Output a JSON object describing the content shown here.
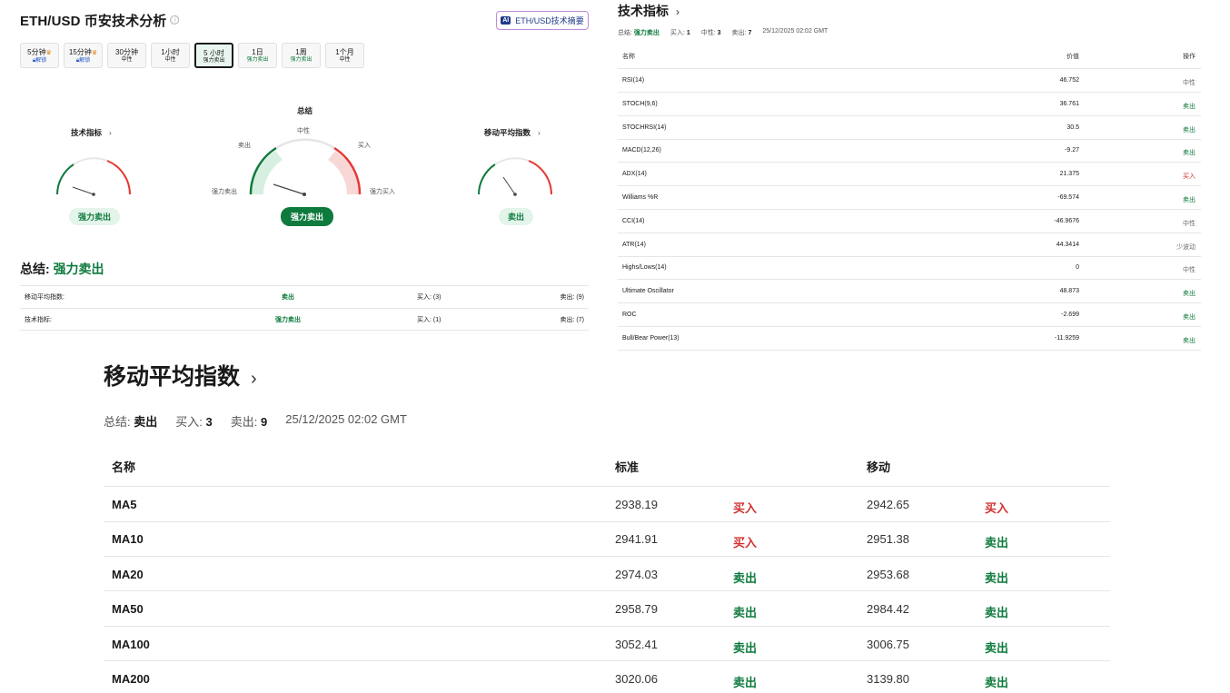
{
  "header": {
    "title": "ETH/USD 币安技术分析",
    "info_icon": "ⓘ",
    "ai_badge": "AI",
    "ai_button": "ETH/USD技术摘要"
  },
  "timeframes": [
    {
      "label": "5分钟",
      "sub": "解锁",
      "locked": true
    },
    {
      "label": "15分钟",
      "sub": "解锁",
      "locked": true
    },
    {
      "label": "30分钟",
      "sub": "中性"
    },
    {
      "label": "1小时",
      "sub": "中性"
    },
    {
      "label": "5 小时",
      "sub": "强力卖出",
      "active": true
    },
    {
      "label": "1日",
      "sub": "强力卖出"
    },
    {
      "label": "1周",
      "sub": "强力卖出"
    },
    {
      "label": "1个月",
      "sub": "中性"
    }
  ],
  "gauges": {
    "technical": {
      "label": "技术指标",
      "result": "强力卖出"
    },
    "summary": {
      "label": "总结",
      "result": "强力卖出",
      "neutral": "中性",
      "sell": "卖出",
      "buy": "买入",
      "strong_sell": "强力卖出",
      "strong_buy": "强力买入"
    },
    "moving_avg": {
      "label": "移动平均指数",
      "result": "卖出"
    },
    "chevron": "›"
  },
  "summary": {
    "title_prefix": "总结:",
    "title_value": "强力卖出",
    "rows": [
      {
        "name": "移动平均指数:",
        "result": "卖出",
        "buy": "买入: (3)",
        "sell": "卖出: (9)"
      },
      {
        "name": "技术指标:",
        "result": "强力卖出",
        "buy": "买入: (1)",
        "sell": "卖出: (7)"
      }
    ]
  },
  "tech_table": {
    "title": "技术指标",
    "sum_label": "总结:",
    "sum_value": "强力卖出",
    "buy_label": "买入:",
    "buy_count": "1",
    "neutral_label": "中性:",
    "neutral_count": "3",
    "sell_label": "卖出:",
    "sell_count": "7",
    "time": "25/12/2025 02:02 GMT",
    "headers": {
      "name": "名称",
      "value": "价值",
      "action": "操作"
    },
    "rows": [
      {
        "name": "RSI(14)",
        "value": "46.752",
        "action": "中性",
        "tone": "gray"
      },
      {
        "name": "STOCH(9,6)",
        "value": "36.761",
        "action": "卖出",
        "tone": "green"
      },
      {
        "name": "STOCHRSI(14)",
        "value": "30.5",
        "action": "卖出",
        "tone": "green"
      },
      {
        "name": "MACD(12,26)",
        "value": "-9.27",
        "action": "卖出",
        "tone": "green"
      },
      {
        "name": "ADX(14)",
        "value": "21.375",
        "action": "买入",
        "tone": "red"
      },
      {
        "name": "Williams %R",
        "value": "-69.574",
        "action": "卖出",
        "tone": "green"
      },
      {
        "name": "CCI(14)",
        "value": "-46.9676",
        "action": "中性",
        "tone": "gray"
      },
      {
        "name": "ATR(14)",
        "value": "44.3414",
        "action": "少波动",
        "tone": "gray"
      },
      {
        "name": "Highs/Lows(14)",
        "value": "0",
        "action": "中性",
        "tone": "gray"
      },
      {
        "name": "Ultimate Oscillator",
        "value": "48.873",
        "action": "卖出",
        "tone": "green"
      },
      {
        "name": "ROC",
        "value": "-2.699",
        "action": "卖出",
        "tone": "green"
      },
      {
        "name": "Bull/Bear Power(13)",
        "value": "-11.9259",
        "action": "卖出",
        "tone": "green"
      }
    ]
  },
  "ma_table": {
    "title": "移动平均指数",
    "sum_label": "总结:",
    "sum_value": "卖出",
    "buy_label": "买入:",
    "buy_count": "3",
    "sell_label": "卖出:",
    "sell_count": "9",
    "time": "25/12/2025 02:02 GMT",
    "headers": {
      "name": "名称",
      "standard": "标准",
      "moving": "移动"
    },
    "rows": [
      {
        "name": "MA5",
        "std": "2938.19",
        "std_action": "买入",
        "std_tone": "red",
        "mov": "2942.65",
        "mov_action": "买入",
        "mov_tone": "red"
      },
      {
        "name": "MA10",
        "std": "2941.91",
        "std_action": "买入",
        "std_tone": "red",
        "mov": "2951.38",
        "mov_action": "卖出",
        "mov_tone": "green"
      },
      {
        "name": "MA20",
        "std": "2974.03",
        "std_action": "卖出",
        "std_tone": "green",
        "mov": "2953.68",
        "mov_action": "卖出",
        "mov_tone": "green"
      },
      {
        "name": "MA50",
        "std": "2958.79",
        "std_action": "卖出",
        "std_tone": "green",
        "mov": "2984.42",
        "mov_action": "卖出",
        "mov_tone": "green"
      },
      {
        "name": "MA100",
        "std": "3052.41",
        "std_action": "卖出",
        "std_tone": "green",
        "mov": "3006.75",
        "mov_action": "卖出",
        "mov_tone": "green"
      },
      {
        "name": "MA200",
        "std": "3020.06",
        "std_action": "卖出",
        "std_tone": "green",
        "mov": "3139.80",
        "mov_action": "卖出",
        "mov_tone": "green"
      }
    ]
  },
  "colors": {
    "sell": "#0e7a3d",
    "buy": "#d32f2f",
    "neutral": "#6b6b6b"
  }
}
